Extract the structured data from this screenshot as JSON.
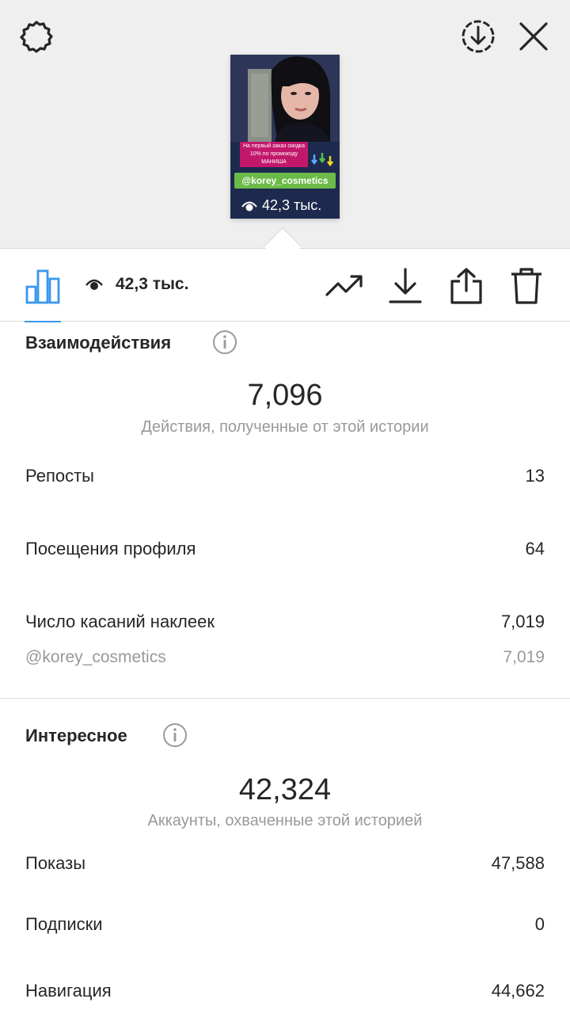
{
  "top_bar": {
    "settings_icon": "gear-icon",
    "download_icon": "download-circle-icon",
    "close_icon": "close-icon"
  },
  "story": {
    "promo_text": "На первый заказ скидка 10% по промокоду МАНИША",
    "handle_sticker": "@korey_cosmetics",
    "views": "42,3 тыс."
  },
  "tabbar": {
    "views": "42,3 тыс.",
    "icons": [
      "bar-chart-icon",
      "eye-icon",
      "trend-icon",
      "download-icon",
      "share-icon",
      "trash-icon"
    ]
  },
  "interactions": {
    "title": "Взаимодействия",
    "total": "7,096",
    "caption": "Действия, полученные от этой истории",
    "rows": [
      {
        "label": "Репосты",
        "value": "13"
      },
      {
        "label": "Посещения профиля",
        "value": "64"
      },
      {
        "label": "Число касаний наклеек",
        "value": "7,019"
      }
    ],
    "sub_row": {
      "label": "@korey_cosmetics",
      "value": "7,019"
    }
  },
  "discovery": {
    "title": "Интересное",
    "total": "42,324",
    "caption": "Аккаунты, охваченные этой историей",
    "rows": [
      {
        "label": "Показы",
        "value": "47,588"
      },
      {
        "label": "Подписки",
        "value": "0"
      },
      {
        "label": "Навигация",
        "value": "44,662"
      }
    ]
  },
  "colors": {
    "accent": "#3897f0",
    "promo": "#c2186b",
    "handle": "#6cba48",
    "muted": "#999999"
  }
}
